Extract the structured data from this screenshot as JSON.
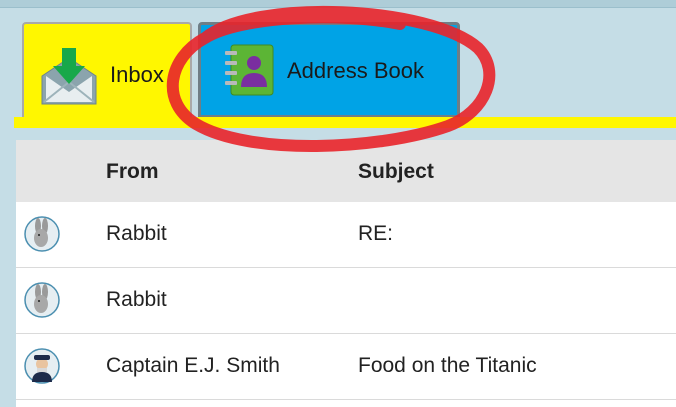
{
  "tabs": [
    {
      "label": "Inbox",
      "icon": "inbox-envelope-icon",
      "active": true
    },
    {
      "label": "Address Book",
      "icon": "address-book-icon",
      "active": false
    }
  ],
  "table": {
    "columns": [
      "From",
      "Subject"
    ],
    "rows": [
      {
        "from": "Rabbit",
        "subject": "RE:",
        "avatar": "rabbit-avatar-icon"
      },
      {
        "from": "Rabbit",
        "subject": "",
        "avatar": "rabbit-avatar-icon"
      },
      {
        "from": "Captain E.J. Smith",
        "subject": "Food on the Titanic",
        "avatar": "captain-avatar-icon"
      }
    ]
  },
  "colors": {
    "active_tab": "#fff700",
    "inactive_tab": "#00a3e6",
    "annotation": "#e8232a"
  }
}
